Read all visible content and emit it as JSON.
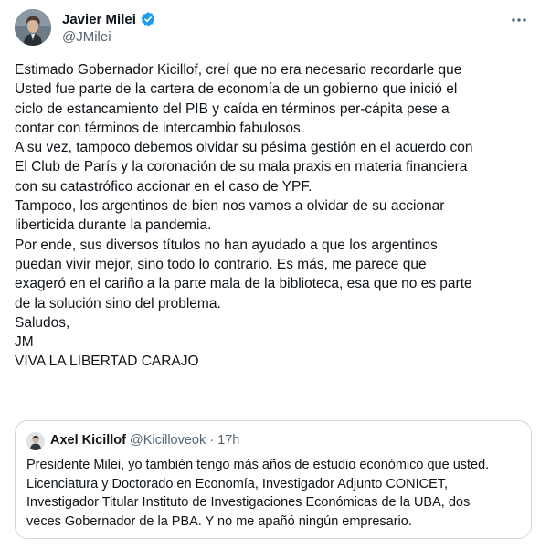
{
  "author": {
    "name": "Javier Milei",
    "handle": "@JMilei"
  },
  "body_lines": [
    "Estimado Gobernador Kicillof, creí que no era necesario recordarle que",
    "Usted fue parte de la cartera de economía de un gobierno que inició el",
    "ciclo de estancamiento del PIB y caída en términos per-cápita pese a",
    "contar con términos de intercambio fabulosos.",
    "A su vez, tampoco debemos olvidar su pésima gestión en el acuerdo con",
    "El Club de París y la coronación de su mala praxis en materia financiera",
    "con su catastrófico accionar en el caso de YPF.",
    "Tampoco, los argentinos de bien nos vamos a olvidar de su accionar",
    "liberticida durante la pandemia.",
    "Por ende, sus diversos títulos no han ayudado a que los argentinos",
    "puedan vivir mejor, sino todo lo contrario. Es más, me parece que",
    "exageró en el cariño a la parte mala de la biblioteca, esa que no es parte",
    "de la solución sino del problema.",
    "Saludos,",
    "JM",
    "VIVA LA LIBERTAD CARAJO"
  ],
  "quote": {
    "name": "Axel Kicillof",
    "handle": "@Kicilloveok",
    "separator": "·",
    "time": "17h",
    "lines": [
      "Presidente Milei, yo también tengo más años de estudio económico que usted.",
      "Licenciatura y Doctorado en Economía, Investigador Adjunto CONICET,",
      "Investigador Titular Instituto de Investigaciones Económicas de la UBA, dos",
      "veces Gobernador de la PBA. Y no me apañó ningún empresario."
    ]
  },
  "colors": {
    "text": "#0f1419",
    "secondary": "#536471",
    "verified": "#1d9bf0",
    "border": "#cfd9de"
  },
  "icons": {
    "verified": "verified-badge-icon",
    "more": "more-horizontal-icon"
  }
}
